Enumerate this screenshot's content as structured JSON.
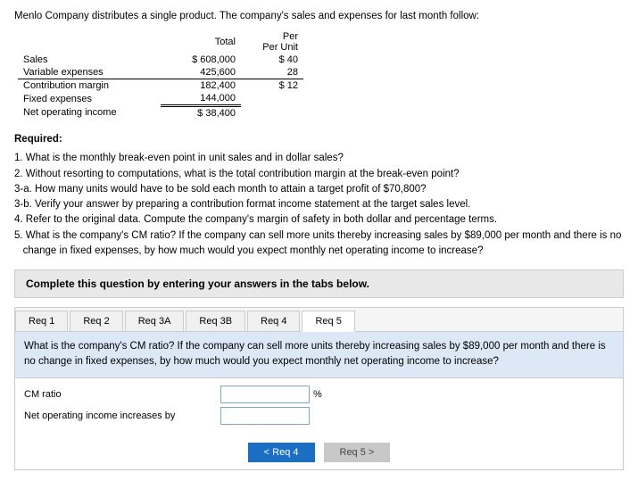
{
  "intro": {
    "text": "Menlo Company distributes a single product. The company's sales and expenses for last month follow:"
  },
  "table": {
    "headers": {
      "total": "Total",
      "per_unit": "Per Unit"
    },
    "rows": [
      {
        "label": "Sales",
        "total": "$ 608,000",
        "per_unit": "$ 40"
      },
      {
        "label": "Variable expenses",
        "total": "425,600",
        "per_unit": "28"
      },
      {
        "label": "Contribution margin",
        "total": "182,400",
        "per_unit": "$ 12"
      },
      {
        "label": "Fixed expenses",
        "total": "144,000",
        "per_unit": ""
      },
      {
        "label": "Net operating income",
        "total": "$ 38,400",
        "per_unit": ""
      }
    ]
  },
  "required": {
    "title": "Required:",
    "items": [
      "1. What is the monthly break-even point in unit sales and in dollar sales?",
      "2. Without resorting to computations, what is the total contribution margin at the break-even point?",
      "3-a. How many units would have to be sold each month to attain a target profit of $70,800?",
      "3-b. Verify your answer by preparing a contribution format income statement at the target sales level.",
      "4. Refer to the original data. Compute the company's margin of safety in both dollar and percentage terms.",
      "5. What is the company's CM ratio? If the company can sell more units thereby increasing sales by $89,000 per month and there is no change in fixed expenses, by how much would you expect monthly net operating income to increase?"
    ]
  },
  "complete_box": {
    "text": "Complete this question by entering your answers in the tabs below."
  },
  "tabs": [
    {
      "label": "Req 1",
      "active": false
    },
    {
      "label": "Req 2",
      "active": false
    },
    {
      "label": "Req 3A",
      "active": false
    },
    {
      "label": "Req 3B",
      "active": false
    },
    {
      "label": "Req 4",
      "active": false
    },
    {
      "label": "Req 5",
      "active": true
    }
  ],
  "tab_content": {
    "text": "What is the company's CM ratio? If the company can sell more units thereby increasing sales by $89,000 per month and there is no change in fixed expenses, by how much would you expect monthly net operating income to increase?"
  },
  "form": {
    "fields": [
      {
        "label": "CM ratio",
        "value": "",
        "unit": "%"
      },
      {
        "label": "Net operating income increases by",
        "value": "",
        "unit": ""
      }
    ]
  },
  "buttons": {
    "prev_label": "< Req 4",
    "next_label": "Req 5 >"
  }
}
